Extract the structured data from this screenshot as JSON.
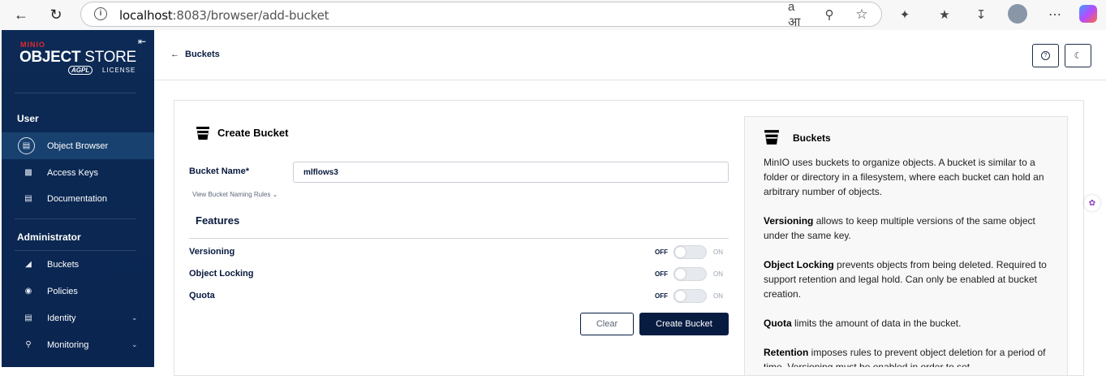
{
  "browser": {
    "url_host": "localhost",
    "url_rest": ":8083/browser/add-bucket"
  },
  "sidebar": {
    "brand_small": "MINIO",
    "brand_bold": "OBJECT",
    "brand_light": " STORE",
    "brand_badge": "AGPL",
    "brand_license": "LICENSE",
    "section_user": "User",
    "section_admin": "Administrator",
    "items": [
      {
        "label": "Object Browser"
      },
      {
        "label": "Access Keys"
      },
      {
        "label": "Documentation"
      },
      {
        "label": "Buckets"
      },
      {
        "label": "Policies"
      },
      {
        "label": "Identity"
      },
      {
        "label": "Monitoring"
      }
    ]
  },
  "header": {
    "back_label": "Buckets"
  },
  "form": {
    "title": "Create Bucket",
    "bucket_name_label": "Bucket Name*",
    "bucket_name_value": "mlflows3",
    "naming_rules_link": "View Bucket Naming Rules",
    "features_heading": "Features",
    "features": [
      {
        "label": "Versioning",
        "off": "OFF",
        "on": "ON",
        "enabled": false
      },
      {
        "label": "Object Locking",
        "off": "OFF",
        "on": "ON",
        "enabled": false
      },
      {
        "label": "Quota",
        "off": "OFF",
        "on": "ON",
        "enabled": false
      }
    ],
    "clear_label": "Clear",
    "create_label": "Create Bucket"
  },
  "help": {
    "title": "Buckets",
    "intro": "MinIO uses buckets to organize objects. A bucket is similar to a folder or directory in a filesystem, where each bucket can hold an arbitrary number of objects.",
    "versioning_term": "Versioning",
    "versioning_text": " allows to keep multiple versions of the same object under the same key.",
    "locking_term": "Object Locking",
    "locking_text": " prevents objects from being deleted. Required to support retention and legal hold. Can only be enabled at bucket creation.",
    "quota_term": "Quota",
    "quota_text": " limits the amount of data in the bucket.",
    "retention_term": "Retention",
    "retention_text": " imposes rules to prevent object deletion for a period of time. Versioning must be enabled in order to set"
  },
  "colors": {
    "sidebar_bg": "#0c2a55",
    "primary": "#081c42"
  }
}
